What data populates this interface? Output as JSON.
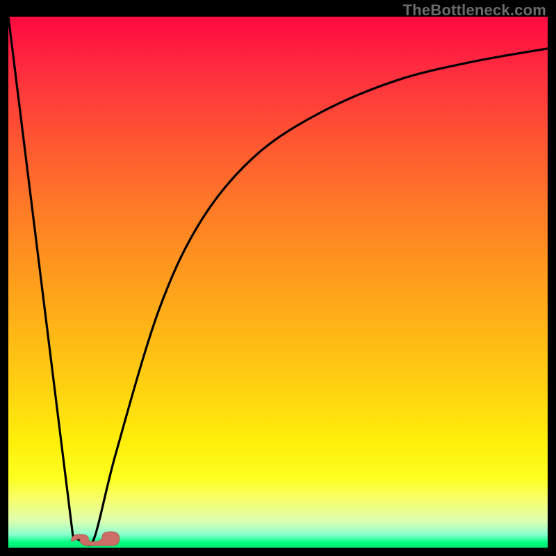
{
  "watermark": "TheBottleneck.com",
  "chart_data": {
    "type": "line",
    "title": "",
    "xlabel": "",
    "ylabel": "",
    "xlim": [
      0,
      100
    ],
    "ylim": [
      0,
      100
    ],
    "grid": false,
    "series": [
      {
        "name": "bottleneck-curve",
        "x": [
          0,
          12,
          14,
          16,
          20,
          28,
          36,
          46,
          58,
          72,
          86,
          100
        ],
        "y": [
          100,
          2,
          1,
          2,
          18,
          45,
          62,
          74,
          82,
          88,
          91.5,
          94
        ],
        "style": "line",
        "color": "#000000"
      }
    ],
    "marker": {
      "name": "optimal-point",
      "x": 14,
      "y": 1.2,
      "color": "#cc6e66",
      "shape": "worm"
    },
    "gradient_stops": [
      {
        "pos": 0.0,
        "color": "#ff0a40"
      },
      {
        "pos": 0.34,
        "color": "#ff7528"
      },
      {
        "pos": 0.7,
        "color": "#ffd210"
      },
      {
        "pos": 0.91,
        "color": "#f7ff6e"
      },
      {
        "pos": 1.0,
        "color": "#00e676"
      }
    ]
  }
}
